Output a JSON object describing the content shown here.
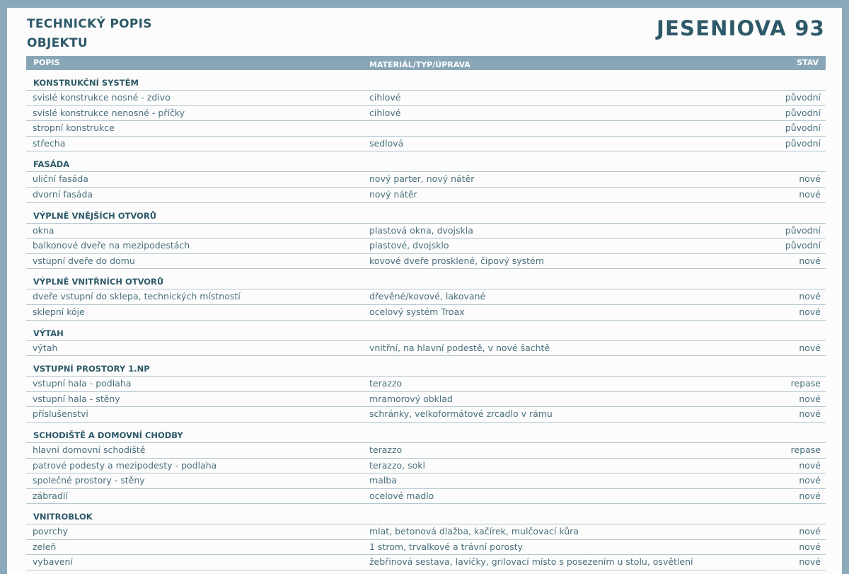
{
  "header": {
    "title_line1": "TECHNICKÝ POPIS",
    "title_line2": "OBJEKTU",
    "address": "JESENIOVA 93"
  },
  "columns": {
    "popis": "POPIS",
    "material": "MATERIÁL/TYP/ÚPRAVA",
    "stav": "STAV"
  },
  "categories": [
    {
      "title": "KONSTRUKČNÍ SYSTÉM",
      "rows": [
        {
          "popis": "svislé konstrukce nosné - zdivo",
          "material": "cihlové",
          "stav": "původní"
        },
        {
          "popis": "svislé konstrukce nenosné - příčky",
          "material": "cihlové",
          "stav": "původní"
        },
        {
          "popis": "stropní konstrukce",
          "material": "",
          "stav": "původní"
        },
        {
          "popis": "střecha",
          "material": "sedlová",
          "stav": "původní"
        }
      ]
    },
    {
      "title": "FASÁDA",
      "rows": [
        {
          "popis": "uliční fasáda",
          "material": "nový parter, nový nátěr",
          "stav": "nové"
        },
        {
          "popis": "dvorní fasáda",
          "material": "nový nátěr",
          "stav": "nové"
        }
      ]
    },
    {
      "title": "VÝPLNĚ VNĚJŠÍCH OTVORŮ",
      "rows": [
        {
          "popis": "okna",
          "material": "plastová okna, dvojskla",
          "stav": "původní"
        },
        {
          "popis": "balkonové dveře na mezipodestách",
          "material": "plastové, dvojsklo",
          "stav": "původní"
        },
        {
          "popis": "vstupní dveře do domu",
          "material": "kovové dveře prosklené, čipový systém",
          "stav": "nové"
        }
      ]
    },
    {
      "title": "VÝPLNĚ VNITŘNÍCH OTVORŮ",
      "rows": [
        {
          "popis": "dveře vstupní do sklepa, technických místností",
          "material": "dřevěné/kovové, lakované",
          "stav": "nové"
        },
        {
          "popis": "sklepní kóje",
          "material": "ocelový systém Troax",
          "stav": "nové"
        }
      ]
    },
    {
      "title": "VÝTAH",
      "rows": [
        {
          "popis": "výtah",
          "material": "vnitřní, na hlavní podestě, v nové šachtě",
          "stav": "nové"
        }
      ]
    },
    {
      "title": "VSTUPNÍ PROSTORY 1.NP",
      "rows": [
        {
          "popis": "vstupní hala - podlaha",
          "material": "terazzo",
          "stav": "repase"
        },
        {
          "popis": "vstupní hala - stěny",
          "material": "mramorový obklad",
          "stav": "nové"
        },
        {
          "popis": "příslušenství",
          "material": "schránky, velkoformátové zrcadlo v rámu",
          "stav": "nové"
        }
      ]
    },
    {
      "title": "SCHODIŠTĚ A DOMOVNÍ CHODBY",
      "rows": [
        {
          "popis": "hlavní domovní schodiště",
          "material": "terazzo",
          "stav": "repase"
        },
        {
          "popis": "patrové podesty a mezipodesty - podlaha",
          "material": "terazzo, sokl",
          "stav": "nové"
        },
        {
          "popis": "společné prostory - stěny",
          "material": "malba",
          "stav": "nové"
        },
        {
          "popis": "zábradlí",
          "material": "ocelové madlo",
          "stav": "nové"
        }
      ]
    },
    {
      "title": "VNITROBLOK",
      "rows": [
        {
          "popis": "povrchy",
          "material": "mlat, betonová dlažba, kačírek, mulčovací kůra",
          "stav": "nové"
        },
        {
          "popis": "zeleň",
          "material": "1 strom, trvalkové a trávní porosty",
          "stav": "nové"
        },
        {
          "popis": "vybavení",
          "material": "žebřinová sestava, lavičky, grilovací místo s posezením u stolu, osvětlení",
          "stav": "nové"
        }
      ]
    }
  ]
}
